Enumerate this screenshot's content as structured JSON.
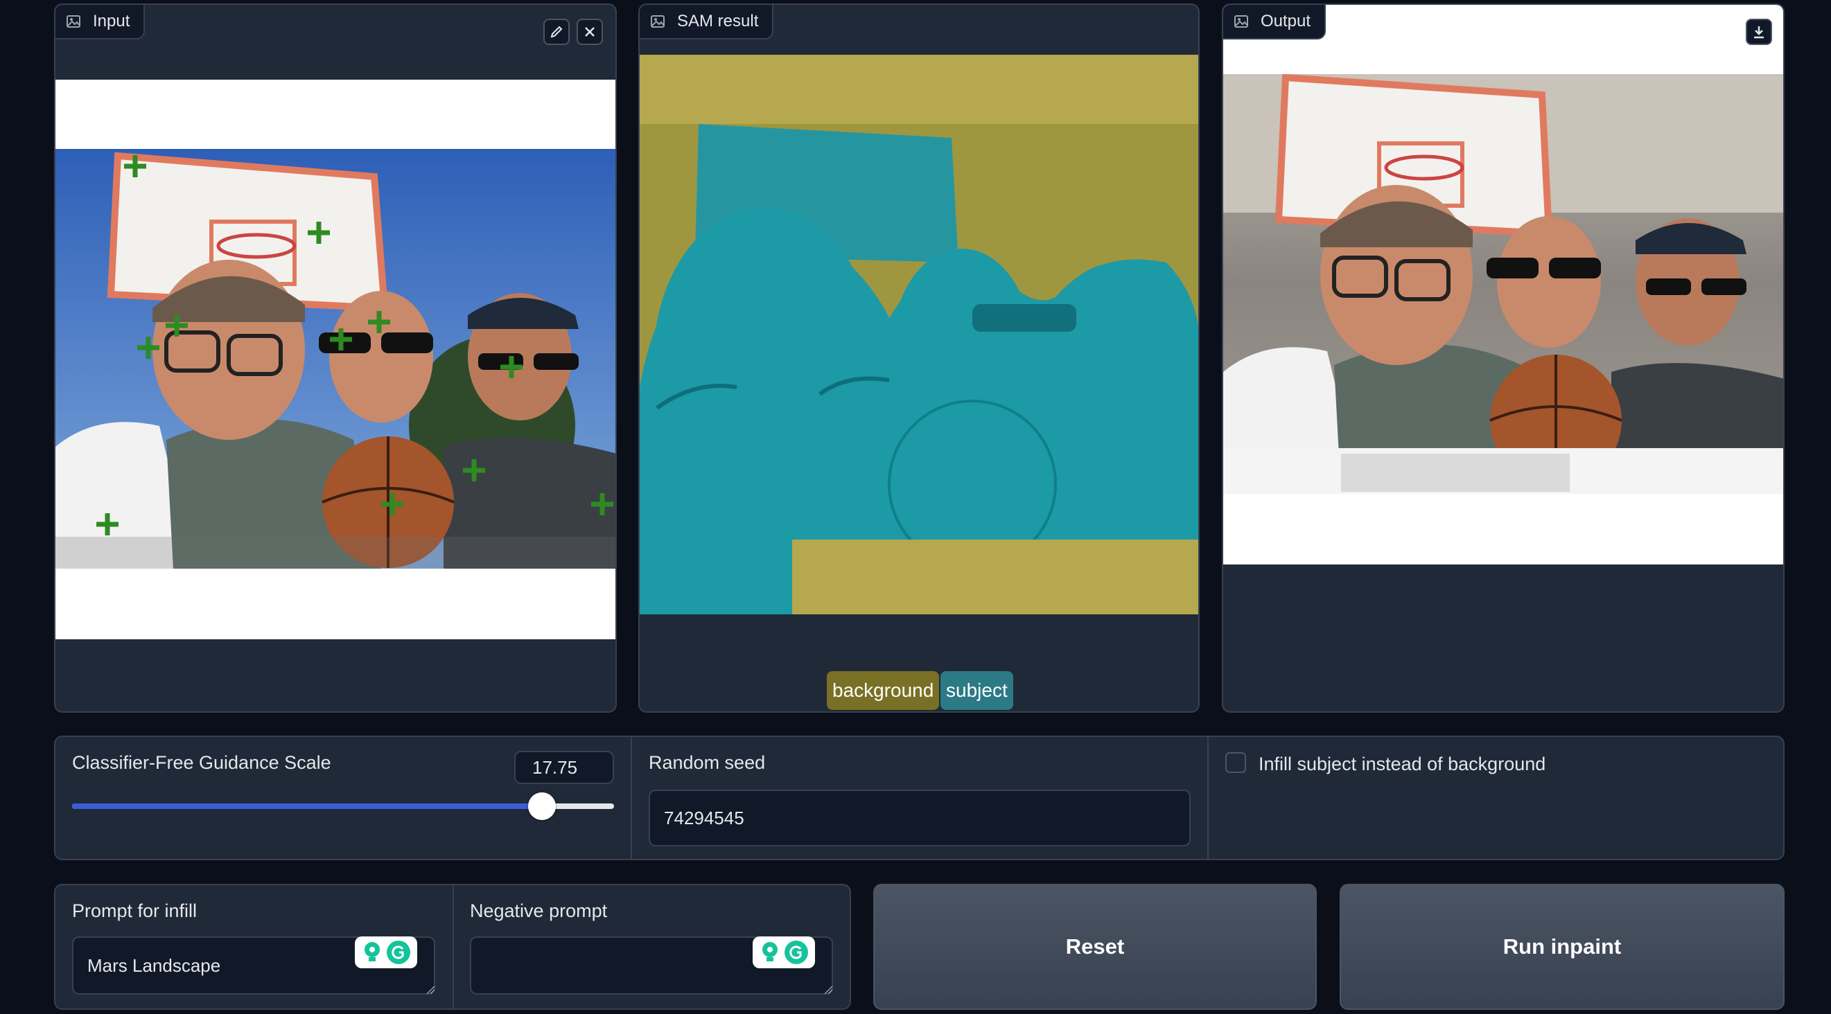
{
  "panels": {
    "input": {
      "label": "Input",
      "icon": "image-icon",
      "actions": [
        "pencil-icon",
        "close-icon"
      ]
    },
    "sam": {
      "label": "SAM result",
      "icon": "image-icon",
      "legend": [
        {
          "label": "background",
          "color": "#7a7025"
        },
        {
          "label": "subject",
          "color": "#2b7a86"
        }
      ]
    },
    "output": {
      "label": "Output",
      "icon": "image-icon",
      "actions": [
        "download-icon"
      ]
    }
  },
  "controls": {
    "cfg": {
      "label": "Classifier-Free Guidance Scale",
      "value": "17.75",
      "fraction": 0.87
    },
    "seed": {
      "label": "Random seed",
      "value": "74294545"
    },
    "infill_subject": {
      "label": "Infill subject instead of background",
      "checked": false
    }
  },
  "prompts": {
    "positive": {
      "label": "Prompt for infill",
      "value": "Mars Landscape"
    },
    "negative": {
      "label": "Negative prompt",
      "value": ""
    }
  },
  "buttons": {
    "reset": "Reset",
    "run": "Run inpaint"
  },
  "colors": {
    "background": "#0b0f19",
    "panel": "#1f2937",
    "accent_slider": "#3b5bdb",
    "point_marker": "#2e8b22",
    "sam_background": "#b5a84e",
    "sam_subject": "#1c9aa6"
  }
}
